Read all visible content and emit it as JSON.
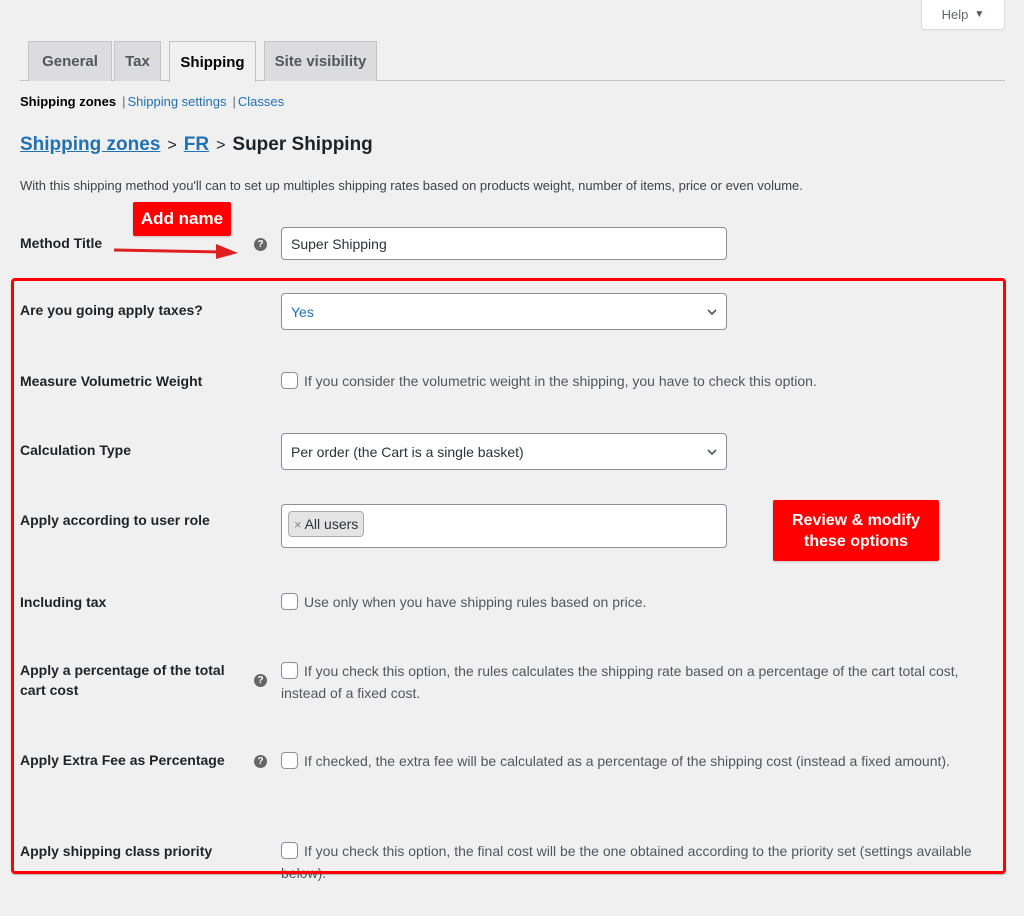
{
  "help": {
    "label": "Help",
    "icon": "triangle-down-icon"
  },
  "tabs": [
    {
      "label": "General",
      "active": false
    },
    {
      "label": "Tax",
      "active": false
    },
    {
      "label": "Shipping",
      "active": true
    },
    {
      "label": "Site visibility",
      "active": false
    }
  ],
  "subnav": {
    "current": "Shipping zones",
    "links": [
      "Shipping settings",
      "Classes"
    ],
    "separator": "|"
  },
  "breadcrumb": {
    "zones": "Shipping zones",
    "sep1": ">",
    "zone": "FR",
    "sep2": ">",
    "current": "Super Shipping"
  },
  "description": "With this shipping method you'll can to set up multiples shipping rates based on products weight, number of items, price or even volume.",
  "fields": {
    "method_title": {
      "label": "Method Title",
      "value": "Super Shipping",
      "help": "?"
    },
    "apply_taxes": {
      "label": "Are you going apply taxes?",
      "value": "Yes"
    },
    "volumetric": {
      "label": "Measure Volumetric Weight",
      "description": "If you consider the volumetric weight in the shipping, you have to check this option.",
      "checked": false
    },
    "calc_type": {
      "label": "Calculation Type",
      "value": "Per order (the Cart is a single basket)"
    },
    "user_role": {
      "label": "Apply according to user role",
      "chips": [
        {
          "remove": "×",
          "label": "All users"
        }
      ]
    },
    "including_tax": {
      "label": "Including tax",
      "description": "Use only when you have shipping rules based on price.",
      "checked": false
    },
    "percentage_cart": {
      "label_line1": "Apply a percentage of the total",
      "label_line2": "cart cost",
      "help": "?",
      "description": "If you check this option, the rules calculates the shipping rate based on a percentage of the cart total cost, instead of a fixed cost.",
      "checked": false
    },
    "extra_fee_pct": {
      "label": "Apply Extra Fee as Percentage",
      "help": "?",
      "description": "If checked, the extra fee will be calculated as a percentage of the shipping cost (instead a fixed amount).",
      "checked": false
    },
    "class_priority": {
      "label": "Apply shipping class priority",
      "description": "If you check this option, the final cost will be the one obtained according to the priority set (settings available below).",
      "checked": false
    }
  },
  "annotations": {
    "add_name": "Add name",
    "review_line1": "Review & modify",
    "review_line2": "these options",
    "color": "#ff0000"
  }
}
